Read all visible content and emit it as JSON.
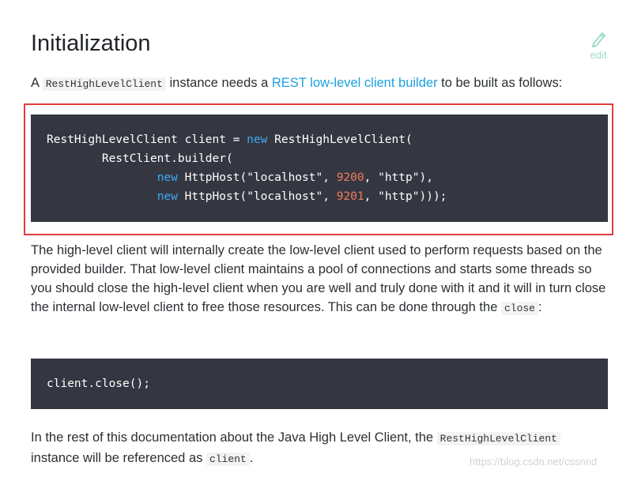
{
  "heading": "Initialization",
  "edit": {
    "label": "edit",
    "icon": "pencil-icon",
    "color": "#9fdcc9"
  },
  "intro": {
    "prefix": "A ",
    "code1": "RestHighLevelClient",
    "middle": " instance needs a ",
    "link": "REST low-level client builder",
    "suffix": " to be built as follows:"
  },
  "code_block_1": {
    "line1": {
      "t1": "RestHighLevelClient client = ",
      "kw": "new",
      "t2": " RestHighLevelClient("
    },
    "line2": {
      "t1": "        RestClient.builder("
    },
    "line3": {
      "indent": "                ",
      "kw": "new",
      "t1": " HttpHost(",
      "s1": "\"localhost\"",
      "t2": ", ",
      "n1": "9200",
      "t3": ", ",
      "s2": "\"http\"",
      "t4": "),"
    },
    "line4": {
      "indent": "                ",
      "kw": "new",
      "t1": " HttpHost(",
      "s1": "\"localhost\"",
      "t2": ", ",
      "n1": "9201",
      "t3": ", ",
      "s2": "\"http\"",
      "t4": ")));"
    }
  },
  "para2": {
    "text": "The high-level client will internally create the low-level client used to perform requests based on the provided builder. That low-level client maintains a pool of connections and starts some threads so you should close the high-level client when you are well and truly done with it and it will in turn close the internal low-level client to free those resources. This can be done through the ",
    "code": "close",
    "suffix": ":"
  },
  "code_block_2": {
    "line1": "client.close();"
  },
  "para3": {
    "prefix": "In the rest of this documentation about the Java High Level Client, the ",
    "code1": "RestHighLevelClient",
    "middle": " instance will be referenced as ",
    "code2": "client",
    "suffix": "."
  },
  "watermark": "https://blog.csdn.net/cssnnd",
  "colors": {
    "keyword": "#3fa9f5",
    "number": "#f07c5c",
    "code_bg": "#343741",
    "link": "#1ba1e2",
    "highlight_frame": "#e63b3b"
  }
}
